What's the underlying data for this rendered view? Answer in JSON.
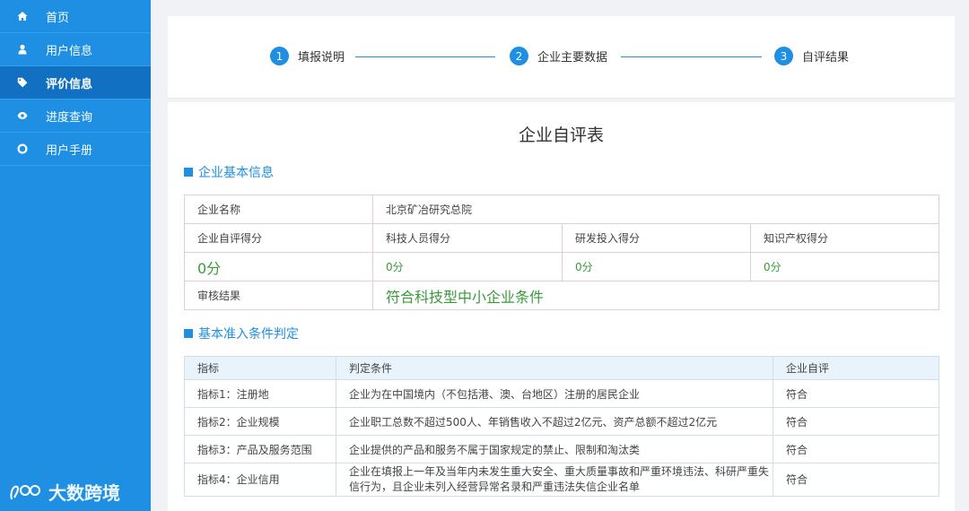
{
  "sidebar": {
    "items": [
      {
        "label": "首页",
        "icon": "home-icon"
      },
      {
        "label": "用户信息",
        "icon": "user-icon"
      },
      {
        "label": "评价信息",
        "icon": "tag-icon"
      },
      {
        "label": "进度查询",
        "icon": "eye-icon"
      },
      {
        "label": "用户手册",
        "icon": "circle-o-icon"
      }
    ],
    "watermark": "大数跨境"
  },
  "steps": [
    {
      "num": "1",
      "label": "填报说明"
    },
    {
      "num": "2",
      "label": "企业主要数据"
    },
    {
      "num": "3",
      "label": "自评结果"
    }
  ],
  "form": {
    "title": "企业自评表",
    "section_basic": "企业基本信息",
    "section_criteria": "基本准入条件判定"
  },
  "basic": {
    "company_name_label": "企业名称",
    "company_name": "北京矿冶研究总院",
    "self_score_label": "企业自评得分",
    "tech_staff_label": "科技人员得分",
    "rd_label": "研发投入得分",
    "ip_label": "知识产权得分",
    "self_score": "0分",
    "tech_staff_score": "0分",
    "rd_score": "0分",
    "ip_score": "0分",
    "audit_label": "审核结果",
    "audit_result": "符合科技型中小企业条件"
  },
  "criteria": {
    "headers": [
      "指标",
      "判定条件",
      "企业自评"
    ],
    "rows": [
      {
        "indicator": "指标1：注册地",
        "condition": "企业为在中国境内（不包括港、澳、台地区）注册的居民企业",
        "result": "符合"
      },
      {
        "indicator": "指标2：企业规模",
        "condition": "企业职工总数不超过500人、年销售收入不超过2亿元、资产总额不超过2亿元",
        "result": "符合"
      },
      {
        "indicator": "指标3：产品及服务范围",
        "condition": "企业提供的产品和服务不属于国家规定的禁止、限制和淘汰类",
        "result": "符合"
      },
      {
        "indicator": "指标4：企业信用",
        "condition": "企业在填报上一年及当年内未发生重大安全、重大质量事故和严重环境违法、科研严重失信行为，且企业未列入经营异常名录和严重违法失信企业名单",
        "result": "符合"
      }
    ]
  },
  "colors": {
    "accent": "#1e8fe3",
    "sidebar_active": "#1170c2",
    "success": "#3a9a3a"
  }
}
